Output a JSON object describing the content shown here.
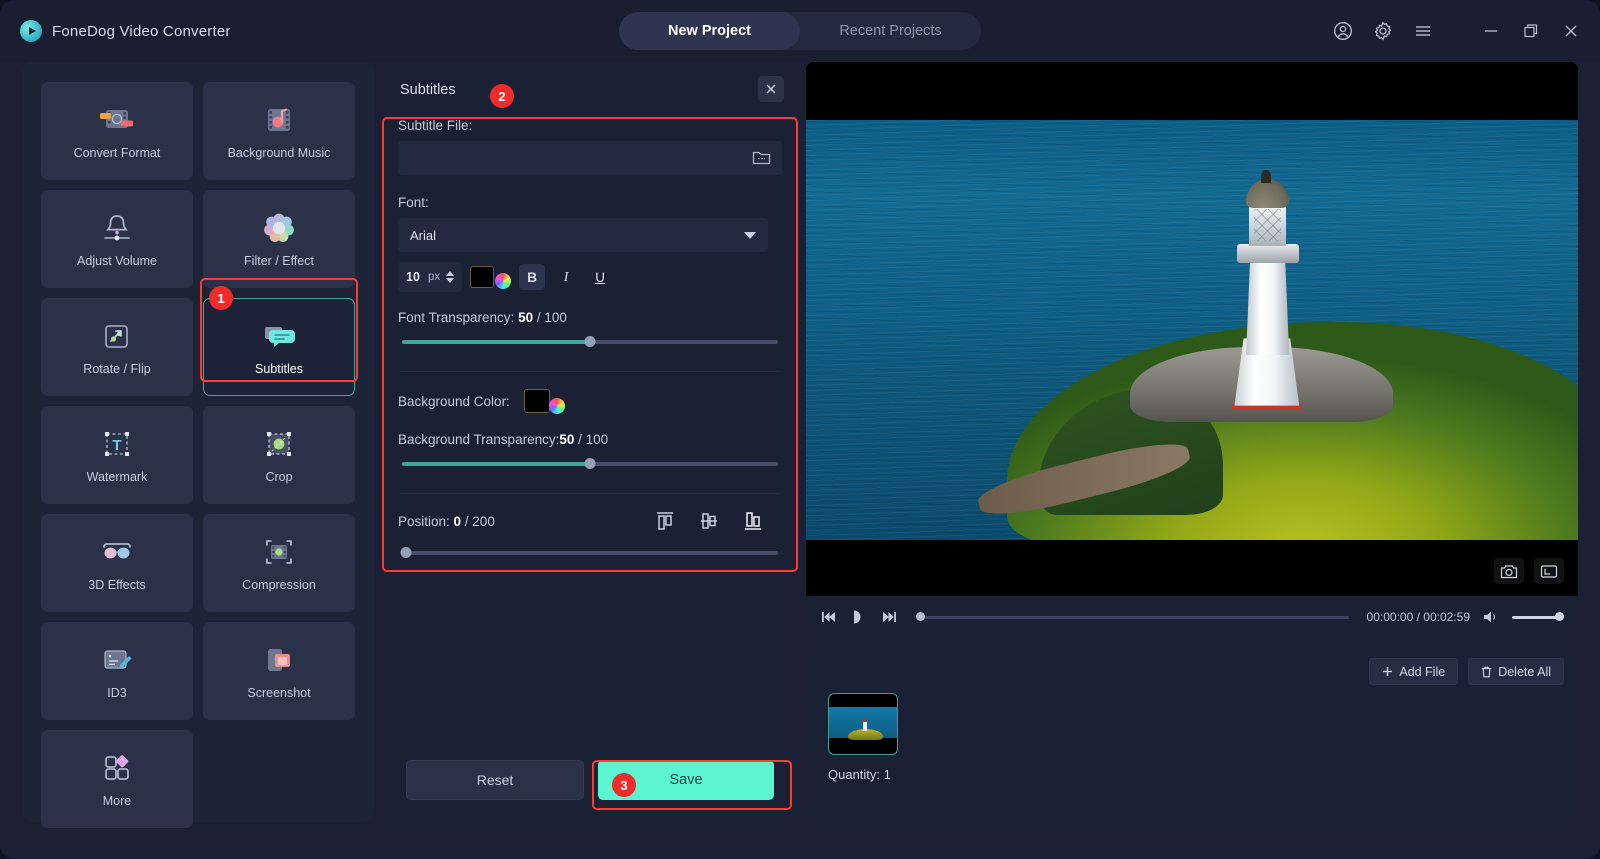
{
  "app": {
    "brand": "FoneDog Video Converter",
    "logo_icon": "play-circle-icon"
  },
  "tabs": [
    {
      "label": "New Project",
      "active": true
    },
    {
      "label": "Recent Projects",
      "active": false
    }
  ],
  "window_controls": [
    {
      "name": "account-icon",
      "glyph": "account"
    },
    {
      "name": "settings-gear-icon",
      "glyph": "gear"
    },
    {
      "name": "menu-hamburger-icon",
      "glyph": "menu"
    },
    {
      "name": "minimize-icon",
      "glyph": "minimize"
    },
    {
      "name": "maximize-icon",
      "glyph": "maximize"
    },
    {
      "name": "close-icon",
      "glyph": "close"
    }
  ],
  "tools": [
    {
      "label": "Convert Format",
      "icon": "convert-format-icon",
      "selected": false
    },
    {
      "label": "Background Music",
      "icon": "background-music-icon",
      "selected": false
    },
    {
      "label": "Adjust Volume",
      "icon": "adjust-volume-icon",
      "selected": false
    },
    {
      "label": "Filter / Effect",
      "icon": "filter-effect-icon",
      "selected": false
    },
    {
      "label": "Rotate / Flip",
      "icon": "rotate-flip-icon",
      "selected": false
    },
    {
      "label": "Subtitles",
      "icon": "subtitles-icon",
      "selected": true
    },
    {
      "label": "Watermark",
      "icon": "watermark-icon",
      "selected": false
    },
    {
      "label": "Crop",
      "icon": "crop-icon",
      "selected": false
    },
    {
      "label": "3D Effects",
      "icon": "3d-effects-icon",
      "selected": false
    },
    {
      "label": "Compression",
      "icon": "compression-icon",
      "selected": false
    },
    {
      "label": "ID3",
      "icon": "id3-icon",
      "selected": false
    },
    {
      "label": "Screenshot",
      "icon": "screenshot-icon",
      "selected": false
    },
    {
      "label": "More",
      "icon": "more-icon",
      "selected": false
    }
  ],
  "annotations": {
    "step1": "1",
    "step2": "2",
    "step3": "3",
    "highlight_color": "#ff3b30"
  },
  "subtitles_panel": {
    "title": "Subtitles",
    "close_icon": "close-icon",
    "subtitle_file": {
      "label": "Subtitle File:",
      "value": "",
      "placeholder": "",
      "browse_icon": "folder-open-icon"
    },
    "font": {
      "label": "Font:",
      "selected": "Arial",
      "dropdown_icon": "chevron-down-icon",
      "size": "10",
      "size_unit": "px",
      "stepper_icon": "spinner-up-down-icon",
      "color_swatch": "#000000",
      "color_wheel_icon": "color-picker-icon",
      "bold_label": "B",
      "italic_label": "I",
      "underline_label": "U",
      "bold_active": true
    },
    "font_transparency": {
      "label_prefix": "Font Transparency: ",
      "value": "50",
      "suffix": " / 100",
      "max": 100
    },
    "background_color": {
      "label": "Background Color:",
      "swatch": "#000000",
      "color_wheel_icon": "color-picker-icon"
    },
    "background_transparency": {
      "label_prefix": "Background Transparency:",
      "value": "50",
      "suffix": " / 100",
      "max": 100
    },
    "position": {
      "label_prefix": "Position: ",
      "value": "0",
      "suffix": " / 200",
      "max": 200,
      "align_buttons": [
        {
          "name": "align-top-icon",
          "active": false
        },
        {
          "name": "align-middle-icon",
          "active": false
        },
        {
          "name": "align-bottom-icon",
          "active": true
        }
      ]
    },
    "reset_label": "Reset",
    "save_label": "Save",
    "save_color": "#5cf5d0"
  },
  "preview": {
    "snapshot_icon": "camera-icon",
    "fullscreen_icon": "fullscreen-icon",
    "prev_icon": "skip-previous-icon",
    "play_icon": "play-icon",
    "next_icon": "skip-next-icon",
    "volume_icon": "volume-icon",
    "time_current": "00:00:00",
    "time_separator": " / ",
    "time_total": "00:02:59",
    "progress_percent": 0,
    "volume_percent": 100
  },
  "file_list": {
    "add_file_label": "Add File",
    "add_file_icon": "plus-icon",
    "delete_all_label": "Delete All",
    "delete_all_icon": "trash-icon",
    "quantity_label": "Quantity: 1",
    "thumbnail_name": "video-thumbnail"
  }
}
